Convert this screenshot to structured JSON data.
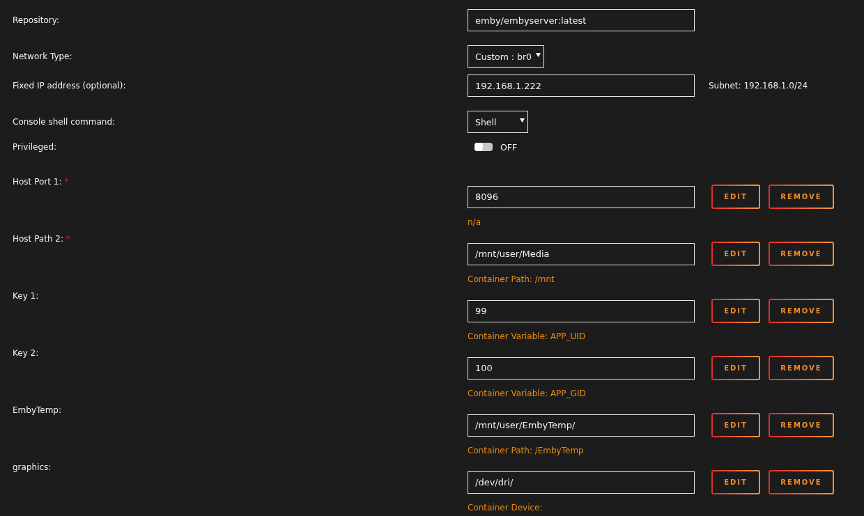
{
  "settings": [
    {
      "kind": "text",
      "label": "Repository:",
      "value": "emby/embyserver:latest"
    },
    {
      "kind": "select",
      "label": "Network Type:",
      "value": "Custom : br0"
    },
    {
      "kind": "text",
      "label": "Fixed IP address (optional):",
      "value": "192.168.1.222",
      "note": "Subnet: 192.168.1.0/24"
    },
    {
      "kind": "select",
      "label": "Console shell command:",
      "value": "Shell"
    },
    {
      "kind": "toggle",
      "label": "Privileged:",
      "on": false,
      "state_text": "OFF"
    }
  ],
  "configs": [
    {
      "label": "Host Port 1:",
      "required_mark": "*",
      "value": "8096",
      "description": "n/a",
      "edit": "EDIT",
      "remove": "REMOVE"
    },
    {
      "label": "Host Path 2:",
      "required_mark": "*",
      "value": "/mnt/user/Media",
      "description": "Container Path: /mnt",
      "edit": "EDIT",
      "remove": "REMOVE"
    },
    {
      "label": "Key 1:",
      "value": "99",
      "description": "Container Variable: APP_UID",
      "edit": "EDIT",
      "remove": "REMOVE"
    },
    {
      "label": "Key 2:",
      "value": "100",
      "description": "Container Variable: APP_GID",
      "edit": "EDIT",
      "remove": "REMOVE"
    },
    {
      "label": "EmbyTemp:",
      "value": "/mnt/user/EmbyTemp/",
      "description": "Container Path: /EmbyTemp",
      "edit": "EDIT",
      "remove": "REMOVE"
    },
    {
      "label": "graphics:",
      "value": "/dev/dri/",
      "description": "Container Device:",
      "edit": "EDIT",
      "remove": "REMOVE"
    }
  ]
}
